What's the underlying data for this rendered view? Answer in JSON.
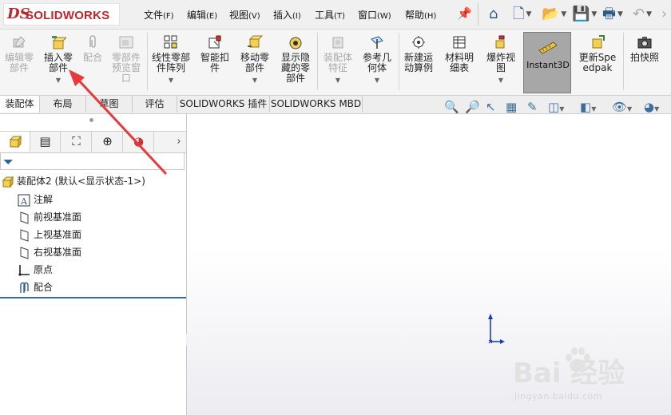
{
  "app": {
    "logo_ds": "DS",
    "logo_text": "SOLIDWORKS"
  },
  "menu": [
    {
      "label": "文件",
      "key": "(F)"
    },
    {
      "label": "编辑",
      "key": "(E)"
    },
    {
      "label": "视图",
      "key": "(V)"
    },
    {
      "label": "插入",
      "key": "(I)"
    },
    {
      "label": "工具",
      "key": "(T)"
    },
    {
      "label": "窗口",
      "key": "(W)"
    },
    {
      "label": "帮助",
      "key": "(H)"
    }
  ],
  "ribbon": {
    "edit_component": "编辑零部件",
    "insert_component": "插入零部件",
    "mate": "配合",
    "component_preview": "零部件预览窗口",
    "linear_pattern": "线性零部件阵列",
    "smart_fasteners": "智能扣件",
    "move_component": "移动零部件",
    "show_hidden": "显示隐藏的零部件",
    "assembly_features": "装配体特征",
    "reference_geometry": "参考几何体",
    "new_motion_study": "新建运动算例",
    "bom": "材料明细表",
    "exploded_view": "爆炸视图",
    "instant3d": "Instant3D",
    "update_speedpak": "更新Speedpak",
    "snapshot": "拍快照"
  },
  "tabs": [
    "装配体",
    "布局",
    "草图",
    "评估",
    "SOLIDWORKS 插件",
    "SOLIDWORKS MBD"
  ],
  "tree": {
    "root": "装配体2 (默认<显示状态-1>)",
    "items": [
      "注解",
      "前视基准面",
      "上视基准面",
      "右视基准面",
      "原点",
      "配合"
    ]
  },
  "watermark": {
    "brand": "Bai 经验",
    "url": "jingyan.baidu.com"
  },
  "colors": {
    "accent": "#2c6ca8",
    "brand_red": "#c0272d",
    "arrow": "#e8393a"
  }
}
